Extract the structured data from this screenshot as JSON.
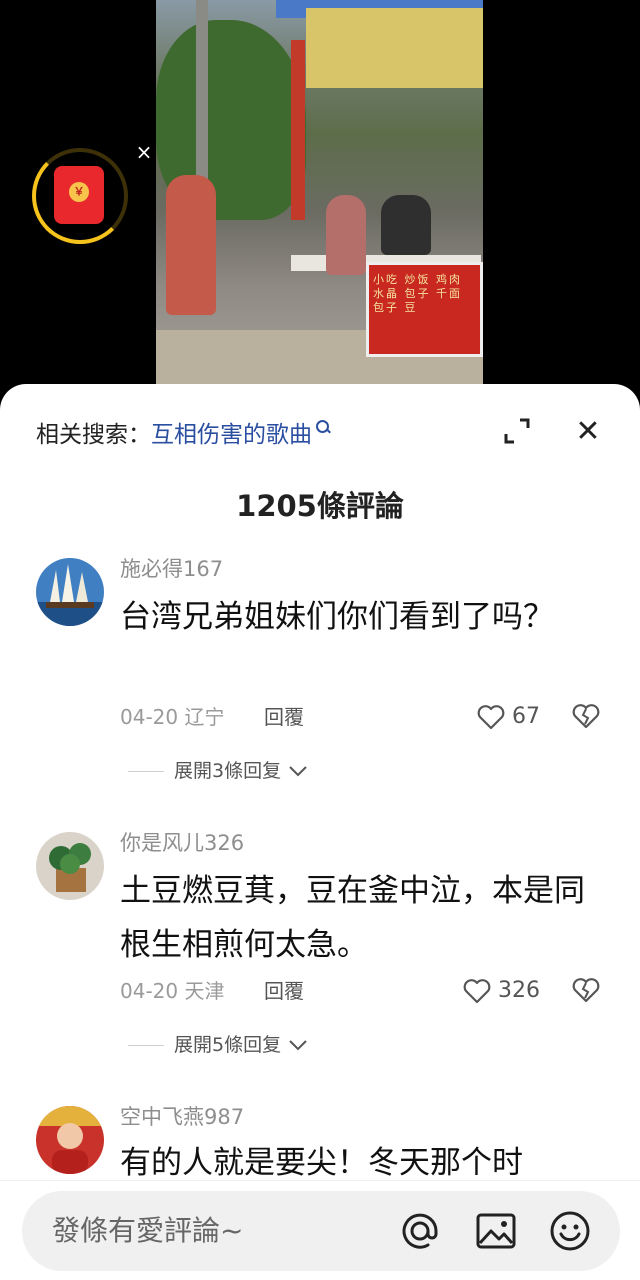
{
  "floating_ad": {
    "seal": "￥",
    "close": "×"
  },
  "video": {
    "stand_text": "小吃 炒饭 鸡肉 水晶 包子 千面 包子 豆"
  },
  "sheet": {
    "related_prefix": "相关搜索：",
    "related_query": "互相伤害的歌曲",
    "close": "✕",
    "comment_count_title": "1205條評論"
  },
  "comments": [
    {
      "user": "施必得167",
      "text": "台湾兄弟姐妹们你们看到了吗？",
      "date_location": "04-20 辽宁",
      "reply_label": "回覆",
      "likes": "67",
      "expand_label": "展開3條回复"
    },
    {
      "user": "你是风儿326",
      "text": "土豆燃豆萁，豆在釜中泣，本是同根生相煎何太急。",
      "date_location": "04-20 天津",
      "reply_label": "回覆",
      "likes": "326",
      "expand_label": "展開5條回复"
    },
    {
      "user": "空中飞燕987",
      "text": "有的人就是要尖！冬天那个时"
    }
  ],
  "input_bar": {
    "placeholder": "發條有愛評論~",
    "icons": [
      "at-icon",
      "image-icon",
      "emoji-icon"
    ]
  },
  "colors": {
    "link_blue": "#2b4fa0",
    "red_envelope": "#e8282d",
    "gold_ring": "#f6c21c"
  }
}
